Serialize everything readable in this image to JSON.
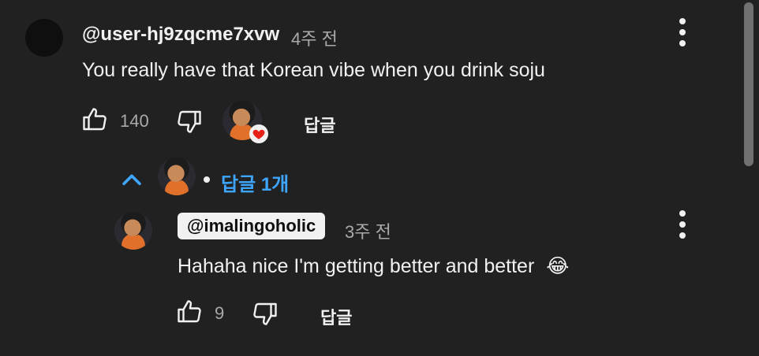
{
  "comment": {
    "author": "@user-hj9zqcme7xvw",
    "time": "4주 전",
    "text": "You really have that Korean vibe when you drink soju",
    "like_count": "140",
    "reply_label": "답글"
  },
  "replies_toggle": {
    "label": "답글 1개"
  },
  "reply": {
    "author": "@imalingoholic",
    "time": "3주 전",
    "text": "Hahaha nice I'm getting better and better",
    "emoji": "😂",
    "like_count": "9",
    "reply_label": "답글"
  },
  "colors": {
    "background": "#212121",
    "accent_blue": "#3ea6ff",
    "heart_red": "#e62117"
  }
}
